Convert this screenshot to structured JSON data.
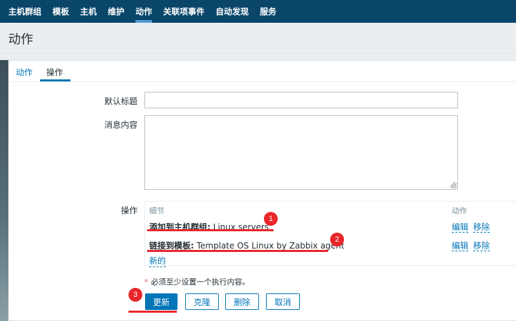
{
  "nav": {
    "items": [
      "主机群组",
      "模板",
      "主机",
      "维护",
      "动作",
      "关联项事件",
      "自动发现",
      "服务"
    ],
    "active_index": 4
  },
  "page": {
    "title": "动作"
  },
  "tabs": [
    {
      "label": "动作",
      "active": false
    },
    {
      "label": "操作",
      "active": true
    }
  ],
  "form": {
    "default_subject_label": "默认标题",
    "default_subject_value": "",
    "message_label": "消息内容",
    "message_value": "",
    "operations_label": "操作"
  },
  "operations": {
    "header_detail": "细节",
    "header_action": "动作",
    "rows": [
      {
        "type": "添加到主机群组:",
        "target": " Linux servers",
        "edit": "编辑",
        "remove": "移除"
      },
      {
        "type": "链接到模板:",
        "target": " Template OS Linux by Zabbix agent",
        "edit": "编辑",
        "remove": "移除"
      }
    ],
    "new_link": "新的"
  },
  "required_note": "必须至少设置一个执行内容。",
  "required_mark": "*",
  "buttons": {
    "update": "更新",
    "clone": "克隆",
    "delete": "删除",
    "cancel": "取消"
  },
  "annotations": [
    "1",
    "2",
    "3"
  ],
  "colors": {
    "nav_bg": "#0a466a",
    "accent": "#0275b8",
    "annotation_red": "#e8262a"
  }
}
